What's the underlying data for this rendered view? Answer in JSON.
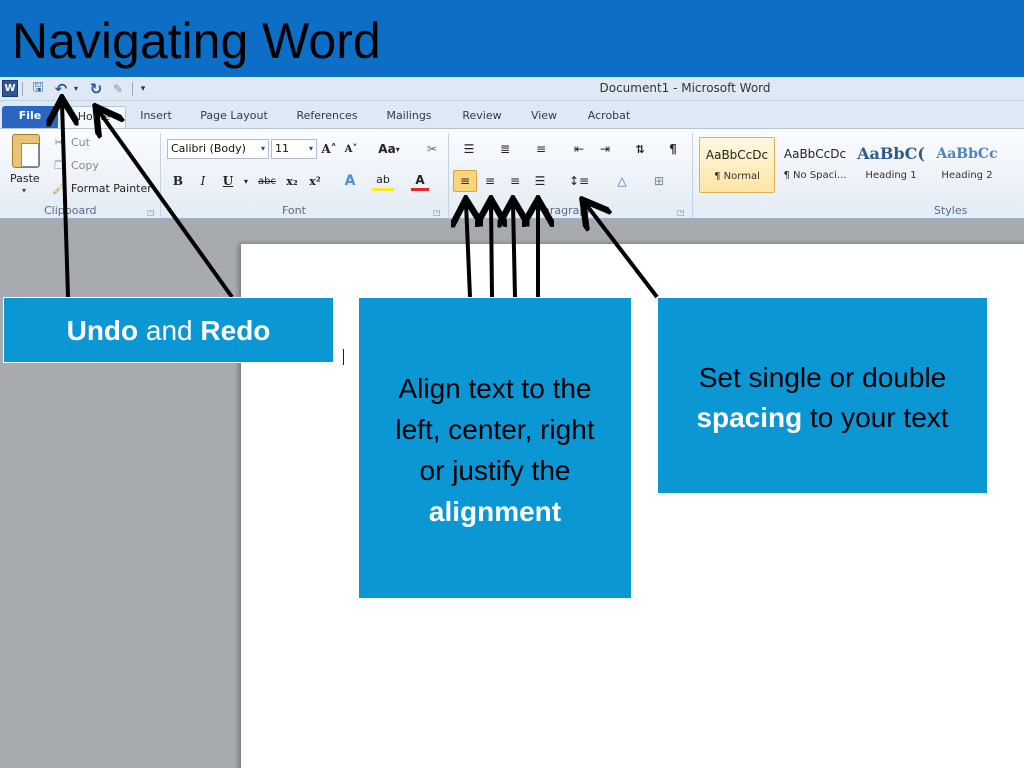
{
  "slide": {
    "title": "Navigating Word"
  },
  "window": {
    "title": "Document1  -  Microsoft Word",
    "word_logo": "W"
  },
  "tabs": [
    {
      "label": "File"
    },
    {
      "label": "Home"
    },
    {
      "label": "Insert"
    },
    {
      "label": "Page Layout"
    },
    {
      "label": "References"
    },
    {
      "label": "Mailings"
    },
    {
      "label": "Review"
    },
    {
      "label": "View"
    },
    {
      "label": "Acrobat"
    }
  ],
  "clipboard": {
    "paste": "Paste",
    "cut": "Cut",
    "copy": "Copy",
    "format_painter": "Format Painter",
    "group_label": "Clipboard"
  },
  "font": {
    "family": "Calibri (Body)",
    "size": "11",
    "change_case": "Aa",
    "group_label": "Font"
  },
  "paragraph": {
    "group_label": "Paragraph"
  },
  "styles": {
    "group_label": "Styles",
    "items": [
      {
        "sample": "AaBbCcDc",
        "name": "¶ Normal"
      },
      {
        "sample": "AaBbCcDc",
        "name": "¶ No Spaci..."
      },
      {
        "sample": "AaBbC(",
        "name": "Heading 1"
      },
      {
        "sample": "AaBbCc",
        "name": "Heading 2"
      }
    ]
  },
  "callouts": {
    "undo_redo": {
      "undo": "Undo",
      "and": " and ",
      "redo": "Redo"
    },
    "alignment": {
      "line1": "Align text to the",
      "line2": "left, center, right",
      "line3": "or justify the",
      "bold": "alignment"
    },
    "spacing": {
      "line1": "Set single or double",
      "bold": "spacing",
      "rest": " to your text"
    }
  },
  "colors": {
    "slide_bg": "#0c6ec4",
    "callout_bg": "#0b96d4",
    "file_tab": "#2a66c1"
  }
}
